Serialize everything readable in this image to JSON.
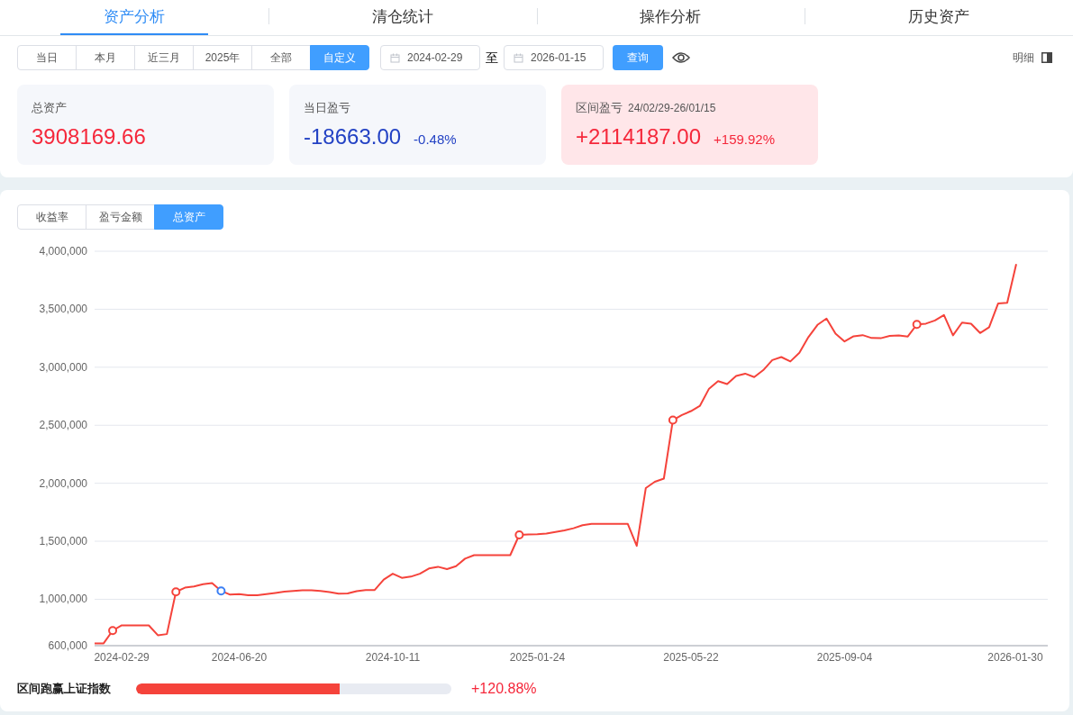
{
  "tabs": [
    {
      "label": "资产分析",
      "selected": true
    },
    {
      "label": "清仓统计",
      "selected": false
    },
    {
      "label": "操作分析",
      "selected": false
    },
    {
      "label": "历史资产",
      "selected": false
    }
  ],
  "period_buttons": [
    {
      "label": "当日",
      "selected": false
    },
    {
      "label": "本月",
      "selected": false
    },
    {
      "label": "近三月",
      "selected": false
    },
    {
      "label": "2025年",
      "selected": false
    },
    {
      "label": "全部",
      "selected": false
    },
    {
      "label": "自定义",
      "selected": true
    }
  ],
  "date_range": {
    "start": "2024-02-29",
    "separator": "至",
    "end": "2026-01-15"
  },
  "query_button": "查询",
  "detail_toggle": {
    "label": "明细"
  },
  "summary_cards": [
    {
      "title": "总资产",
      "value": "3908169.66",
      "kind": "up"
    },
    {
      "title": "当日盈亏",
      "value": "-18663.00",
      "change": "-0.48%",
      "kind": "down"
    },
    {
      "title": "区间盈亏",
      "subtitle": "24/02/29-26/01/15",
      "value": "+2114187.00",
      "change": "+159.92%",
      "kind": "up_highlight"
    }
  ],
  "chart_tabs": [
    {
      "label": "收益率",
      "selected": false
    },
    {
      "label": "盈亏金额",
      "selected": false
    },
    {
      "label": "总资产",
      "selected": true
    }
  ],
  "chart": {
    "chart_data": {
      "type": "line",
      "ylim": [
        600000,
        4000000
      ],
      "categories": [
        null,
        null,
        null,
        "2024-02-29",
        null,
        null,
        null,
        null,
        null,
        null,
        null,
        null,
        null,
        null,
        null,
        null,
        "2024-06-20",
        null,
        null,
        null,
        null,
        null,
        null,
        null,
        null,
        null,
        null,
        null,
        null,
        null,
        null,
        null,
        null,
        "2024-10-11",
        null,
        null,
        null,
        null,
        null,
        null,
        null,
        null,
        null,
        null,
        null,
        null,
        null,
        null,
        null,
        "2025-01-24",
        null,
        null,
        null,
        null,
        null,
        null,
        null,
        null,
        null,
        null,
        null,
        null,
        null,
        null,
        null,
        null,
        "2025-05-22",
        null,
        null,
        null,
        null,
        null,
        null,
        null,
        null,
        null,
        null,
        null,
        null,
        null,
        null,
        null,
        null,
        "2025-09-04",
        null,
        null,
        null,
        null,
        null,
        null,
        null,
        null,
        null,
        null,
        null,
        null,
        null,
        null,
        null,
        null,
        null,
        null,
        "2026-01-30"
      ],
      "grid": true,
      "series": [
        {
          "type": "line",
          "color": "#f5433b",
          "values": [
            620000,
            620000,
            730000,
            775000,
            775000,
            775000,
            775000,
            690000,
            700000,
            1064000,
            1100000,
            1110000,
            1130000,
            1140000,
            1072000,
            1040000,
            1045000,
            1035000,
            1035000,
            1045000,
            1055000,
            1065000,
            1072000,
            1078000,
            1078000,
            1072000,
            1062000,
            1048000,
            1050000,
            1070000,
            1080000,
            1080000,
            1170000,
            1220000,
            1185000,
            1195000,
            1220000,
            1265000,
            1280000,
            1260000,
            1285000,
            1350000,
            1380000,
            1380000,
            1380000,
            1380000,
            1380000,
            1555000,
            1558000,
            1560000,
            1567000,
            1580000,
            1593000,
            1612000,
            1638000,
            1650000,
            1650000,
            1650000,
            1650000,
            1650000,
            1460000,
            1958000,
            2013000,
            2040000,
            2544000,
            2588000,
            2622000,
            2668000,
            2815000,
            2880000,
            2855000,
            2925000,
            2945000,
            2915000,
            2975000,
            3062000,
            3088000,
            3050000,
            3125000,
            3260000,
            3365000,
            3420000,
            3290000,
            3222000,
            3267000,
            3277000,
            3252000,
            3250000,
            3270000,
            3275000,
            3265000,
            3369000,
            3376000,
            3403000,
            3450000,
            3275000,
            3385000,
            3375000,
            3295000,
            3345000,
            3550000,
            3555000,
            3890000
          ]
        },
        {
          "type": "scatter",
          "color": "#f5433b",
          "values": [
            null,
            null,
            730000,
            null,
            null,
            null,
            null,
            null,
            null,
            1064000,
            null,
            null,
            null,
            null,
            null,
            null,
            null,
            null,
            null,
            null,
            null,
            null,
            null,
            null,
            null,
            null,
            null,
            null,
            null,
            null,
            null,
            null,
            null,
            null,
            null,
            null,
            null,
            null,
            null,
            null,
            null,
            null,
            null,
            null,
            null,
            null,
            null,
            1555000,
            null,
            null,
            null,
            null,
            null,
            null,
            null,
            null,
            null,
            null,
            null,
            null,
            null,
            null,
            null,
            null,
            2544000,
            null,
            null,
            null,
            null,
            null,
            null,
            null,
            null,
            null,
            null,
            null,
            null,
            null,
            null,
            null,
            null,
            null,
            null,
            null,
            null,
            null,
            null,
            null,
            null,
            null,
            null,
            3369000,
            null,
            null,
            null,
            null,
            null,
            null,
            null,
            null,
            null,
            null,
            null
          ]
        },
        {
          "type": "scatter",
          "color": "#3b7ff5",
          "values": [
            null,
            null,
            null,
            null,
            null,
            null,
            null,
            null,
            null,
            null,
            null,
            null,
            null,
            null,
            1072000,
            null,
            null,
            null,
            null,
            null,
            null,
            null,
            null,
            null,
            null,
            null,
            null,
            null,
            null,
            null,
            null,
            null,
            null,
            null,
            null,
            null,
            null,
            null,
            null,
            null,
            null,
            null,
            null,
            null,
            null,
            null,
            null,
            null,
            null,
            null,
            null,
            null,
            null,
            null,
            null,
            null,
            null,
            null,
            null,
            null,
            null,
            null,
            null,
            null,
            null,
            null,
            null,
            null,
            null,
            null,
            null,
            null,
            null,
            null,
            null,
            null,
            null,
            null,
            null,
            null,
            null,
            null,
            null,
            null,
            null,
            null,
            null,
            null,
            null,
            null,
            null,
            null,
            null,
            null,
            null,
            null,
            null,
            null,
            null,
            null,
            null,
            null,
            null
          ]
        }
      ],
      "yticks": [
        {
          "value": 600000,
          "label": "600,000"
        },
        {
          "value": 1000000,
          "label": "1,000,000"
        },
        {
          "value": 1500000,
          "label": "1,500,000"
        },
        {
          "value": 2000000,
          "label": "2,000,000"
        },
        {
          "value": 2500000,
          "label": "2,500,000"
        },
        {
          "value": 3000000,
          "label": "3,000,000"
        },
        {
          "value": 3500000,
          "label": "3,500,000"
        },
        {
          "value": 4000000,
          "label": "4,000,000"
        }
      ]
    }
  },
  "benchmark": {
    "label": "区间跑赢上证指数",
    "level": 0.645,
    "value": "+120.88%"
  }
}
